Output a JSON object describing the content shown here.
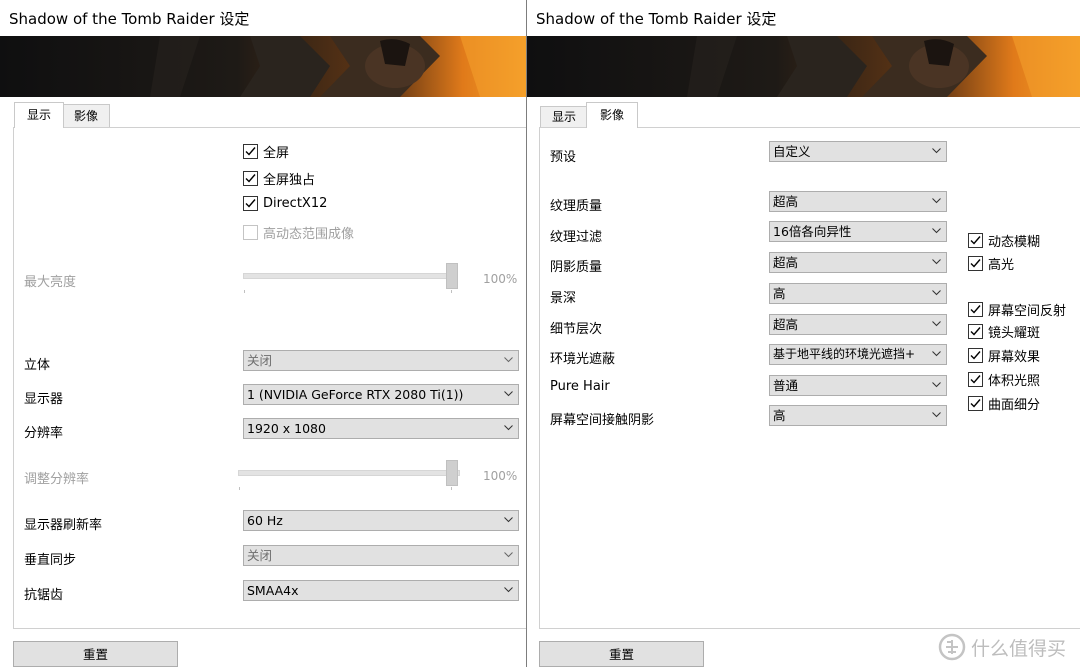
{
  "windows": {
    "left": {
      "title": "Shadow of the Tomb Raider 设定",
      "tabs": [
        "显示",
        "影像"
      ],
      "checkboxes": [
        {
          "label": "全屏",
          "checked": true
        },
        {
          "label": "全屏独占",
          "checked": true
        },
        {
          "label": "DirectX12",
          "checked": true
        },
        {
          "label": "高动态范围成像",
          "checked": false,
          "disabled": true
        }
      ],
      "brightness": {
        "label": "最大亮度",
        "value": "100%"
      },
      "stereo": {
        "label": "立体",
        "value": "关闭"
      },
      "monitor": {
        "label": "显示器",
        "value": "1 (NVIDIA GeForce RTX 2080 Ti(1))"
      },
      "resolution": {
        "label": "分辨率",
        "value": "1920 x 1080"
      },
      "res_scale": {
        "label": "调整分辨率",
        "value": "100%"
      },
      "refresh": {
        "label": "显示器刷新率",
        "value": "60 Hz"
      },
      "vsync": {
        "label": "垂直同步",
        "value": "关闭"
      },
      "aa": {
        "label": "抗锯齿",
        "value": "SMAA4x"
      },
      "reset": "重置"
    },
    "right": {
      "title": "Shadow of the Tomb Raider 设定",
      "tabs": [
        "显示",
        "影像"
      ],
      "preset": {
        "label": "预设",
        "value": "自定义"
      },
      "settings": [
        {
          "label": "纹理质量",
          "value": "超高"
        },
        {
          "label": "纹理过滤",
          "value": "16倍各向异性"
        },
        {
          "label": "阴影质量",
          "value": "超高"
        },
        {
          "label": "景深",
          "value": "高"
        },
        {
          "label": "细节层次",
          "value": "超高"
        },
        {
          "label": "环境光遮蔽",
          "value": "基于地平线的环境光遮挡+"
        },
        {
          "label": "Pure Hair",
          "value": "普通"
        },
        {
          "label": "屏幕空间接触阴影",
          "value": "高"
        }
      ],
      "checkboxes_a": [
        {
          "label": "动态模糊",
          "checked": true
        },
        {
          "label": "高光",
          "checked": true
        }
      ],
      "checkboxes_b": [
        {
          "label": "屏幕空间反射",
          "checked": true
        },
        {
          "label": "镜头耀斑",
          "checked": true
        },
        {
          "label": "屏幕效果",
          "checked": true
        },
        {
          "label": "体积光照",
          "checked": true
        },
        {
          "label": "曲面细分",
          "checked": true
        }
      ],
      "reset": "重置"
    }
  },
  "watermark": "什么值得买",
  "icons": {
    "checkmark": "checkmark-icon",
    "chevron": "chevron-down-icon",
    "watermark_logo": "smzdm-logo-icon"
  }
}
